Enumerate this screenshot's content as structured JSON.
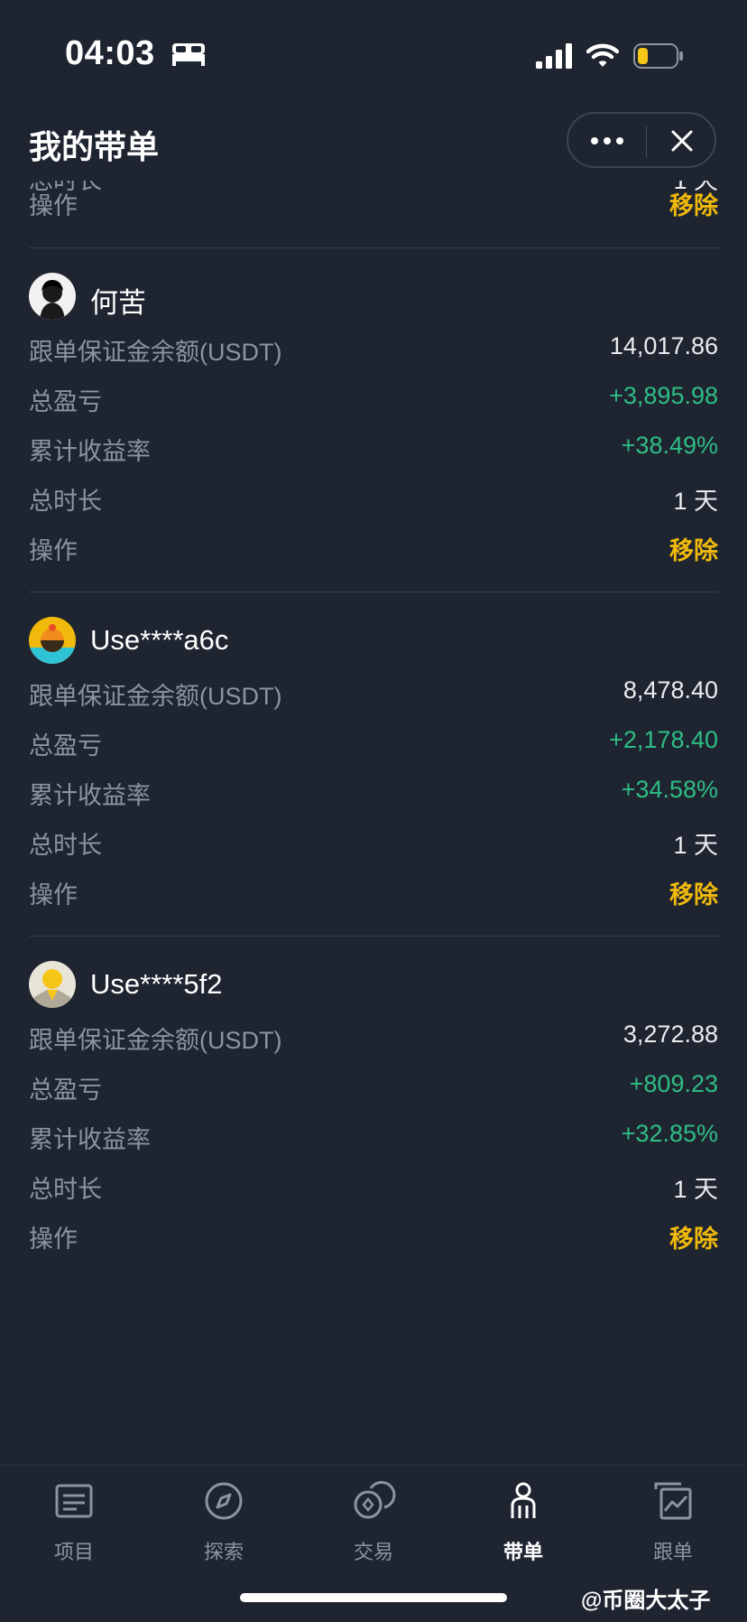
{
  "status_bar": {
    "time": "04:03",
    "icons": [
      "bed-icon",
      "signal-icon",
      "wifi-icon",
      "battery-icon"
    ]
  },
  "header": {
    "title": "我的带单"
  },
  "partial_row": {
    "label": "操作",
    "value": "移除"
  },
  "labels": {
    "margin": "跟单保证金余额(USDT)",
    "pnl": "总盈亏",
    "roi": "累计收益率",
    "duration": "总时长",
    "action": "操作"
  },
  "traders": [
    {
      "name": "何苦",
      "margin": "14,017.86",
      "pnl": "+3,895.98",
      "roi": "+38.49%",
      "duration": "1 天",
      "action": "移除"
    },
    {
      "name": "Use****a6c",
      "margin": "8,478.40",
      "pnl": "+2,178.40",
      "roi": "+34.58%",
      "duration": "1 天",
      "action": "移除"
    },
    {
      "name": "Use****5f2",
      "margin": "3,272.88",
      "pnl": "+809.23",
      "roi": "+32.85%",
      "duration": "1 天",
      "action": "移除"
    }
  ],
  "tabs": [
    {
      "label": "项目",
      "icon": "list-icon"
    },
    {
      "label": "探索",
      "icon": "compass-icon"
    },
    {
      "label": "交易",
      "icon": "exchange-icon"
    },
    {
      "label": "带单",
      "icon": "person-icon"
    },
    {
      "label": "跟单",
      "icon": "copy-chart-icon"
    }
  ],
  "active_tab": "带单",
  "watermark": "@币圈大太子",
  "colors": {
    "background": "#1f2530",
    "positive": "#2ebd85",
    "action": "#f0b90b",
    "label": "#8e949e"
  }
}
